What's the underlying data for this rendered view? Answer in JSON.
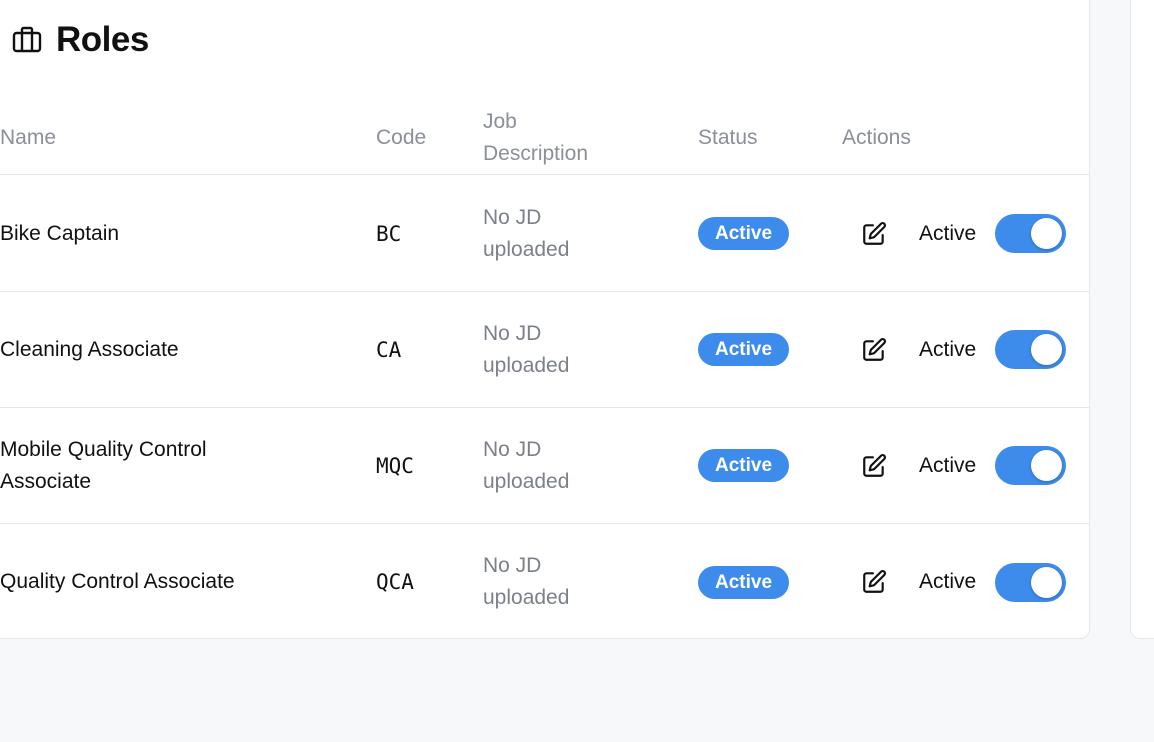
{
  "page": {
    "title": "Roles",
    "title_icon": "briefcase-icon"
  },
  "table": {
    "headers": {
      "name": "Name",
      "code": "Code",
      "job_description": "Job Description",
      "status": "Status",
      "actions": "Actions"
    },
    "rows": [
      {
        "name": "Bike Captain",
        "code": "BC",
        "jd": "No JD uploaded",
        "status": "Active",
        "toggle_label": "Active",
        "toggle_on": true
      },
      {
        "name": "Cleaning Associate",
        "code": "CA",
        "jd": "No JD uploaded",
        "status": "Active",
        "toggle_label": "Active",
        "toggle_on": true
      },
      {
        "name": "Mobile Quality Control Associate",
        "code": "MQC",
        "jd": "No JD uploaded",
        "status": "Active",
        "toggle_label": "Active",
        "toggle_on": true
      },
      {
        "name": "Quality Control Associate",
        "code": "QCA",
        "jd": "No JD uploaded",
        "status": "Active",
        "toggle_label": "Active",
        "toggle_on": true
      }
    ]
  },
  "icons": {
    "edit": "edit-icon"
  },
  "colors": {
    "accent": "#3d8cec",
    "muted_text": "#8b8f98",
    "border": "#e5e7eb",
    "background": "#f7f8fa"
  }
}
